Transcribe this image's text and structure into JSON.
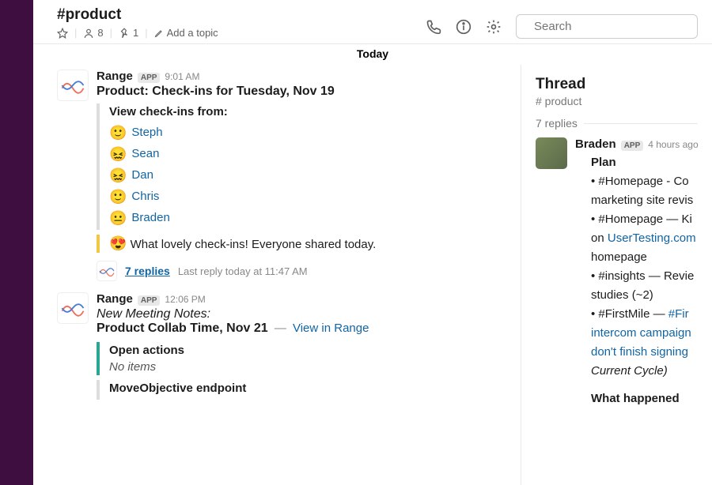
{
  "channel": {
    "name": "#product",
    "member_count": "8",
    "pin_count": "1",
    "topic_prompt": "Add a topic"
  },
  "search": {
    "placeholder": "Search"
  },
  "date_divider": "Today",
  "messages": [
    {
      "author": "Range",
      "badge": "APP",
      "time": "9:01 AM",
      "title": "Product: Check-ins for Tuesday, Nov 19",
      "checkins_label": "View check-ins from:",
      "checkins": [
        {
          "emoji": "🙂",
          "name": "Steph"
        },
        {
          "emoji": "😖",
          "name": "Sean"
        },
        {
          "emoji": "😖",
          "name": "Dan"
        },
        {
          "emoji": "🙂",
          "name": "Chris"
        },
        {
          "emoji": "😐",
          "name": "Braden"
        }
      ],
      "praise": {
        "emoji": "😍",
        "text": "What lovely check-ins! Everyone shared today."
      },
      "replies": {
        "count": "7 replies",
        "last": "Last reply today at 11:47 AM"
      }
    },
    {
      "author": "Range",
      "badge": "APP",
      "time": "12:06 PM",
      "subtitle_italic": "New Meeting Notes:",
      "meeting_title": "Product Collab Time, Nov 21",
      "view_link": "View in Range",
      "open_actions_label": "Open actions",
      "open_actions_items": "No items",
      "endpoint_label": "MoveObjective endpoint"
    }
  ],
  "thread": {
    "title": "Thread",
    "subtitle": "# product",
    "reply_count": "7 replies",
    "msg": {
      "author": "Braden",
      "badge": "APP",
      "time": "4 hours ago",
      "plan_label": "Plan",
      "plan_lines": [
        "• #Homepage - Co",
        "marketing site revis",
        "• #Homepage — Ki",
        "on ",
        "UserTesting.com",
        "homepage",
        "• #insights — Revie",
        "studies (~2)",
        "• #FirstMile — ",
        "#Fir",
        "intercom campaign",
        "don't finish signing",
        " ",
        "Current Cycle)"
      ],
      "what_happened_label": "What happened"
    }
  }
}
